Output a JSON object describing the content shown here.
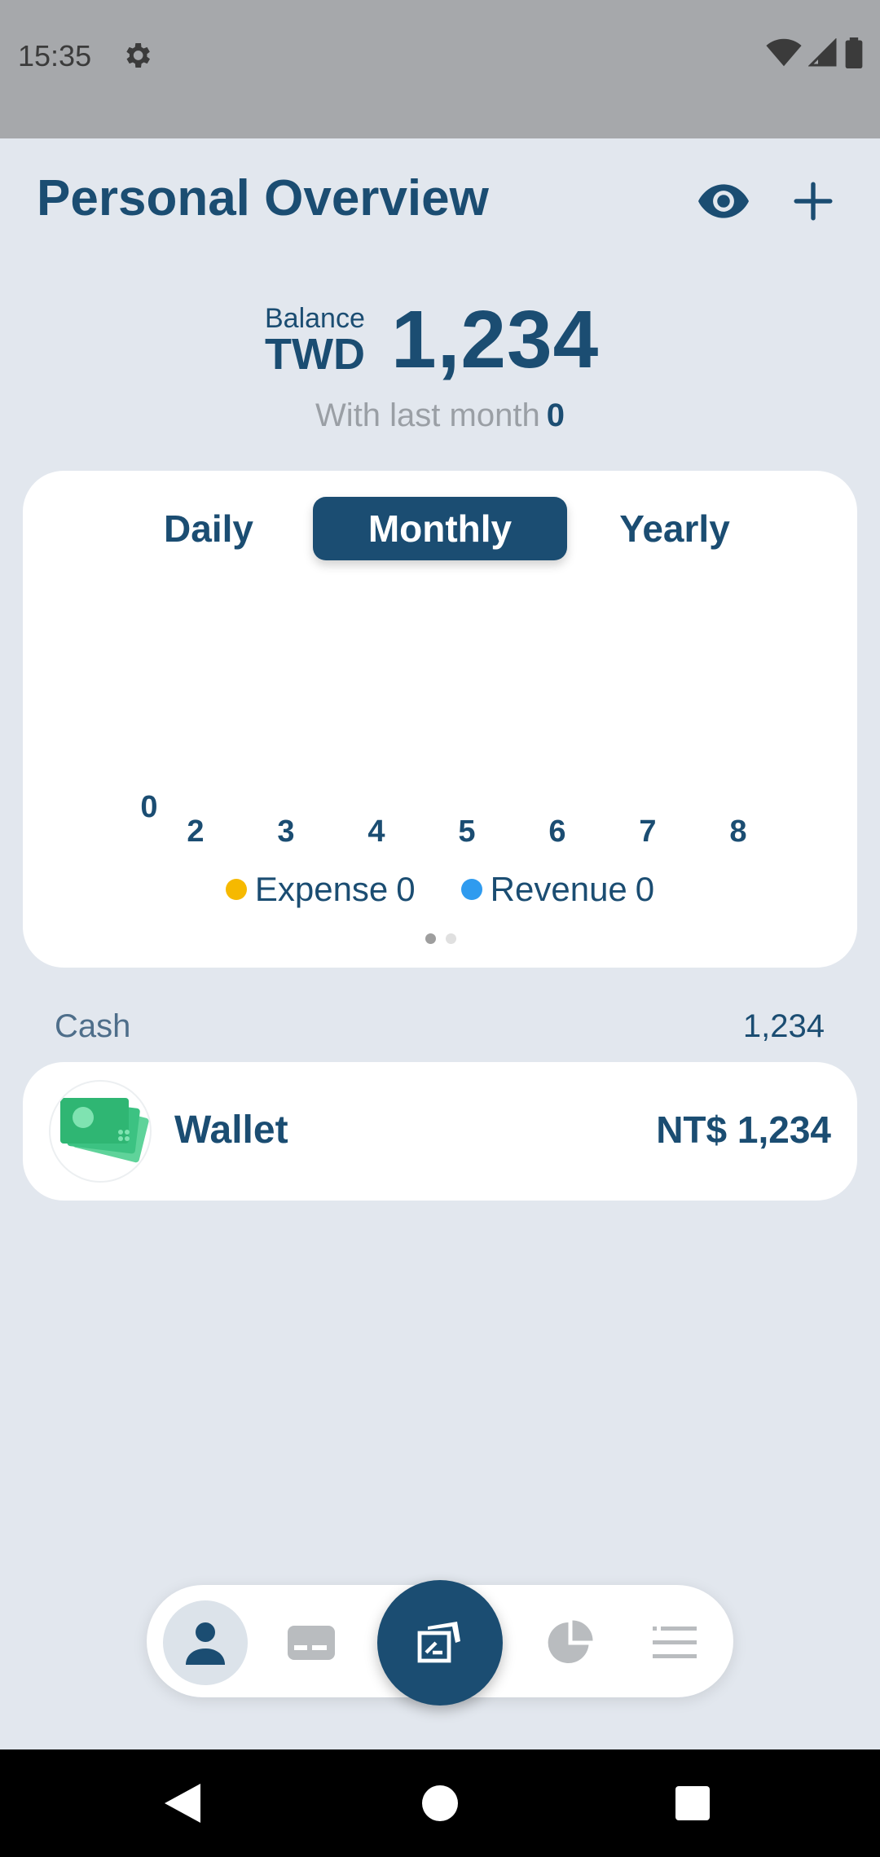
{
  "status_bar": {
    "time": "15:35"
  },
  "header": {
    "title": "Personal Overview"
  },
  "balance": {
    "label": "Balance",
    "currency": "TWD",
    "amount": "1,234",
    "last_month_label": "With last month",
    "last_month_value": "0"
  },
  "tabs": {
    "daily": "Daily",
    "monthly": "Monthly",
    "yearly": "Yearly",
    "selected": "Monthly"
  },
  "chart_data": {
    "type": "bar",
    "y_tick_labels": [
      "0"
    ],
    "categories": [
      "2",
      "3",
      "4",
      "5",
      "6",
      "7",
      "8"
    ],
    "series": [
      {
        "name": "Expense",
        "values": [
          0,
          0,
          0,
          0,
          0,
          0,
          0
        ],
        "color": "#f6b900"
      },
      {
        "name": "Revenue",
        "values": [
          0,
          0,
          0,
          0,
          0,
          0,
          0
        ],
        "color": "#2f9bef"
      }
    ],
    "legend": [
      {
        "label": "Expense",
        "value": "0",
        "color": "#f6b900"
      },
      {
        "label": "Revenue",
        "value": "0",
        "color": "#2f9bef"
      }
    ],
    "legend_position": "bottom",
    "grid": false
  },
  "pager": {
    "pages": 2,
    "active": 1
  },
  "section": {
    "label": "Cash",
    "total": "1,234"
  },
  "account": {
    "name": "Wallet",
    "amount": "NT$ 1,234",
    "icon": "money-icon"
  },
  "bottom_nav": {
    "items": [
      "person-icon",
      "card-icon",
      "add-record-icon",
      "pie-chart-icon",
      "menu-icon"
    ],
    "active": "person-icon"
  },
  "colors": {
    "primary": "#1b4d72",
    "background": "#e2e7ee",
    "card": "#ffffff"
  }
}
